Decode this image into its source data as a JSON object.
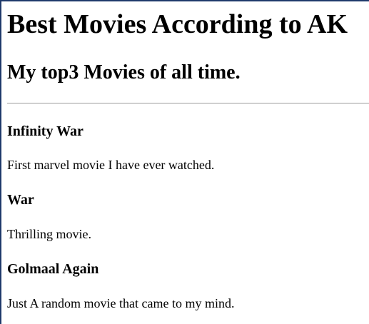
{
  "page": {
    "heading": "Best Movies According to AK",
    "subheading": "My top3 Movies of all time."
  },
  "movies": [
    {
      "title": "Infinity War",
      "description": "First marvel movie I have ever watched."
    },
    {
      "title": "War",
      "description": "Thrilling movie."
    },
    {
      "title": "Golmaal Again",
      "description": "Just A random movie that came to my mind."
    }
  ],
  "colors": {
    "frame": "#1f3a6b",
    "divider": "#9a9a9a",
    "text": "#000000",
    "background": "#ffffff"
  }
}
